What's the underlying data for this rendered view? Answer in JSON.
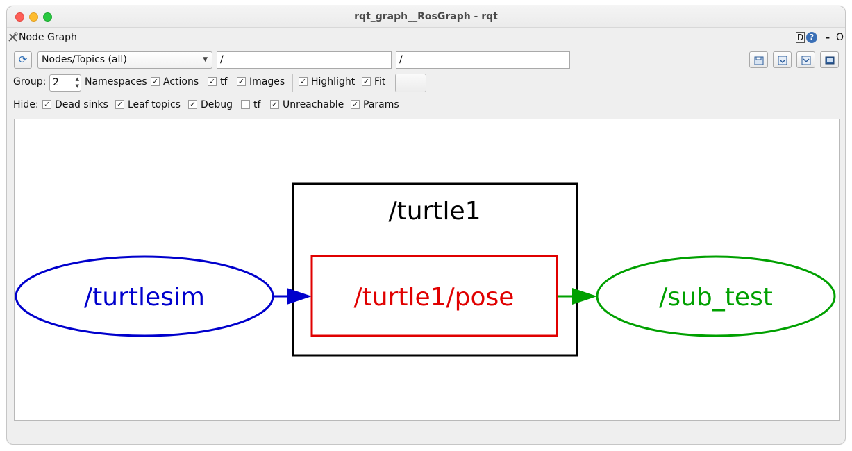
{
  "window": {
    "title": "rqt_graph__RosGraph - rqt"
  },
  "plugin": {
    "title": "Node Graph",
    "icon": "tools-icon",
    "d_label": "D",
    "help_label": "?",
    "dash_label": "-",
    "o_label": "O"
  },
  "toolbar": {
    "refresh_icon": "refresh-icon",
    "view_mode": "Nodes/Topics (all)",
    "node_filter": "/",
    "topic_filter": "/",
    "tool_icons": [
      "load-dot-icon",
      "save-dot-icon",
      "save-svg-icon",
      "save-image-icon"
    ]
  },
  "options": {
    "group_label": "Group:",
    "group_value": "2",
    "namespaces": {
      "label": "Namespaces",
      "checked": true
    },
    "actions": {
      "label": "Actions",
      "checked": true
    },
    "tf": {
      "label": "tf",
      "checked": true
    },
    "images": {
      "label": "Images",
      "checked": true
    },
    "highlight": {
      "label": "Highlight",
      "checked": true
    },
    "fit": {
      "label": "Fit",
      "checked": true
    }
  },
  "hide": {
    "label": "Hide:",
    "dead_sinks": {
      "label": "Dead sinks",
      "checked": true
    },
    "leaf_topics": {
      "label": "Leaf topics",
      "checked": true
    },
    "debug": {
      "label": "Debug",
      "checked": true
    },
    "tf": {
      "label": "tf",
      "checked": false
    },
    "unreachable": {
      "label": "Unreachable",
      "checked": true
    },
    "params": {
      "label": "Params",
      "checked": true
    }
  },
  "graph": {
    "group": {
      "label": "/turtle1"
    },
    "nodes": [
      {
        "id": "turtlesim",
        "label": "/turtlesim",
        "shape": "ellipse",
        "color": "#0000cc"
      },
      {
        "id": "pose",
        "label": "/turtle1/pose",
        "shape": "box",
        "color": "#e00000"
      },
      {
        "id": "sub_test",
        "label": "/sub_test",
        "shape": "ellipse",
        "color": "#00a000"
      }
    ],
    "edges": [
      {
        "from": "turtlesim",
        "to": "pose",
        "color": "#0000cc"
      },
      {
        "from": "pose",
        "to": "sub_test",
        "color": "#00a000"
      }
    ]
  },
  "colors": {
    "publisher": "#0000cc",
    "topic": "#e00000",
    "subscriber": "#00a000"
  }
}
